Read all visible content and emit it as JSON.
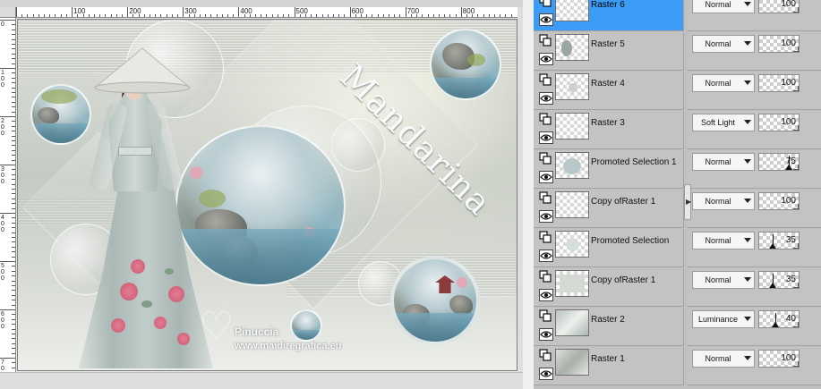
{
  "canvas": {
    "ruler_h_labels": [
      "100",
      "200",
      "300",
      "400",
      "500",
      "600",
      "700",
      "800",
      "900"
    ],
    "ruler_v_labels": [
      "0",
      "100",
      "200",
      "300",
      "400",
      "500",
      "600",
      "700"
    ],
    "image_title_text": "Mandarina",
    "watermark_name": "Pinuccia",
    "watermark_url": "www.maidiregrafica.eu"
  },
  "layers": [
    {
      "name": "Raster 6",
      "blend_mode": "Normal",
      "opacity": 100,
      "selected": true
    },
    {
      "name": "Raster 5",
      "blend_mode": "Normal",
      "opacity": 100,
      "selected": false
    },
    {
      "name": "Raster 4",
      "blend_mode": "Normal",
      "opacity": 100,
      "selected": false
    },
    {
      "name": "Raster 3",
      "blend_mode": "Soft Light",
      "opacity": 100,
      "selected": false
    },
    {
      "name": "Promoted Selection 1",
      "blend_mode": "Normal",
      "opacity": 75,
      "selected": false
    },
    {
      "name": "Copy ofRaster 1",
      "blend_mode": "Normal",
      "opacity": 100,
      "selected": false
    },
    {
      "name": "Promoted Selection",
      "blend_mode": "Normal",
      "opacity": 35,
      "selected": false
    },
    {
      "name": "Copy ofRaster 1",
      "blend_mode": "Normal",
      "opacity": 35,
      "selected": false
    },
    {
      "name": "Raster 2",
      "blend_mode": "Luminance",
      "opacity": 40,
      "selected": false
    },
    {
      "name": "Raster 1",
      "blend_mode": "Normal",
      "opacity": 100,
      "selected": false
    }
  ],
  "icons": {
    "layer_type": "raster-layer-icon",
    "visibility": "eye-icon",
    "dropdown": "chevron-down-icon",
    "splitter": "chevron-right-icon"
  },
  "colors": {
    "selection": "#3d9cf5",
    "panel_bg": "#c3c3c3"
  }
}
